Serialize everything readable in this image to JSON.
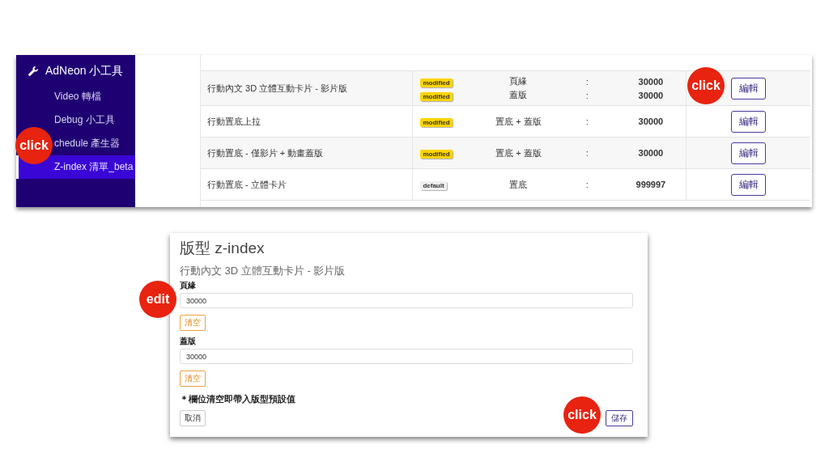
{
  "sidebar": {
    "title": "AdNeon 小工具",
    "items": [
      {
        "label": "Video 轉檔",
        "selected": false
      },
      {
        "label": "Debug 小工具",
        "selected": false
      },
      {
        "label": "chedule 產生器",
        "selected": false
      },
      {
        "label": "Z-index 清單_beta",
        "selected": true
      }
    ]
  },
  "table": {
    "rows": [
      {
        "name": "行動內文 3D 立體互動卡片 - 影片版",
        "action": "編輯",
        "entries": [
          {
            "status": "modified",
            "kind": "modified",
            "type": "頁緣",
            "sep": ":",
            "value": "30000"
          },
          {
            "status": "modified",
            "kind": "modified",
            "type": "蓋版",
            "sep": ":",
            "value": "30000"
          }
        ]
      },
      {
        "name": "行動置底上拉",
        "action": "編輯",
        "entries": [
          {
            "status": "modified",
            "kind": "modified",
            "type": "置底 + 蓋版",
            "sep": ":",
            "value": "30000"
          }
        ]
      },
      {
        "name": "行動置底 - 僅影片 + 動畫蓋版",
        "action": "編輯",
        "entries": [
          {
            "status": "modified",
            "kind": "modified",
            "type": "置底 + 蓋版",
            "sep": ":",
            "value": "30000"
          }
        ]
      },
      {
        "name": "行動置底 - 立體卡片",
        "action": "編輯",
        "entries": [
          {
            "status": "default",
            "kind": "default",
            "type": "置底",
            "sep": ":",
            "value": "999997"
          }
        ]
      }
    ]
  },
  "dialog": {
    "title": "版型 z-index",
    "subtitle": "行動內文 3D 立體互動卡片 - 影片版",
    "fields": [
      {
        "label": "頁緣",
        "value": "30000",
        "clear": "清空"
      },
      {
        "label": "蓋版",
        "value": "30000",
        "clear": "清空"
      }
    ],
    "note": "＊欄位清空即帶入版型預設值",
    "cancel": "取消",
    "save": "儲存"
  },
  "annotations": [
    {
      "text": "click"
    },
    {
      "text": "click"
    },
    {
      "text": "edit"
    },
    {
      "text": "click"
    }
  ]
}
